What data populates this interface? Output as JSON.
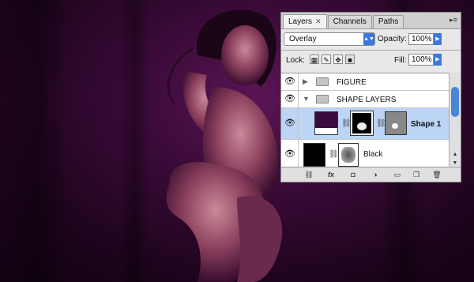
{
  "panel": {
    "tabs": [
      {
        "label": "Layers",
        "close": "✕",
        "active": true
      },
      {
        "label": "Channels",
        "active": false
      },
      {
        "label": "Paths",
        "active": false
      }
    ],
    "menu_icon": "panel-menu-icon",
    "blend_mode": "Overlay",
    "opacity_label": "Opacity:",
    "opacity_value": "100%",
    "lock_label": "Lock:",
    "fill_label": "Fill:",
    "fill_value": "100%"
  },
  "layers": [
    {
      "name": "FIGURE",
      "type": "group",
      "expanded": false,
      "visible": true
    },
    {
      "name": "SHAPE LAYERS",
      "type": "group",
      "expanded": true,
      "visible": true
    },
    {
      "name": "Shape 1",
      "type": "shape",
      "selected": true,
      "visible": true,
      "fill_color": "#3d0a3d"
    },
    {
      "name": "Black",
      "type": "layer",
      "visible": true,
      "fill_color": "#000000"
    }
  ],
  "colors": {
    "selection": "#bcd4f5",
    "accent": "#3b78d9",
    "canvas_bg": "#3a0a38"
  }
}
